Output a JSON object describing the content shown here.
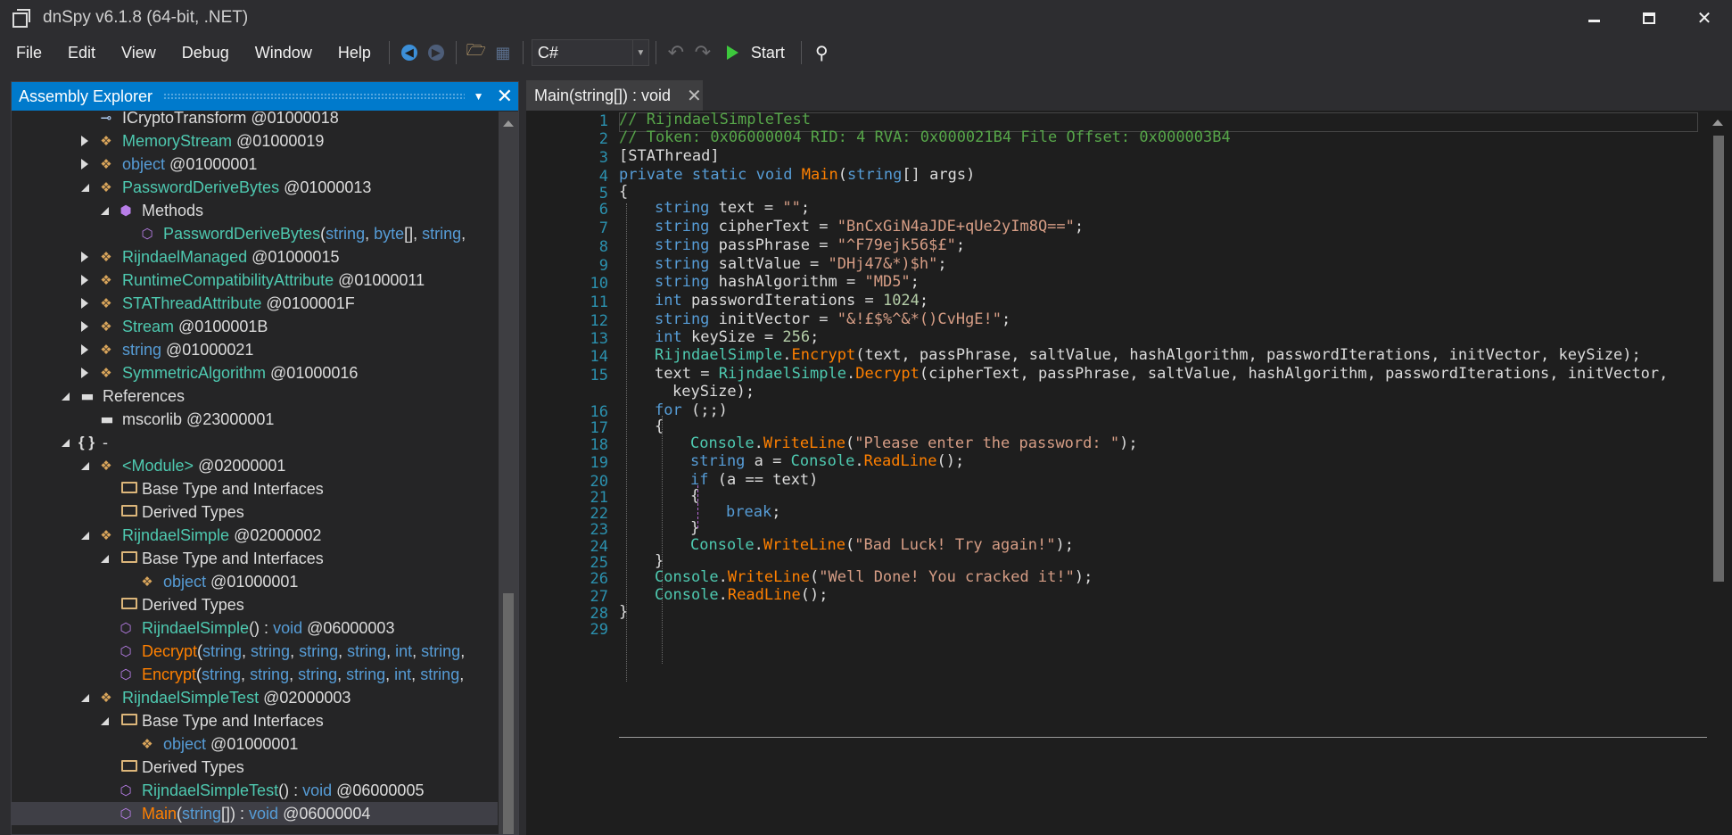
{
  "window": {
    "title": "dnSpy v6.1.8 (64-bit, .NET)"
  },
  "menu": [
    "File",
    "Edit",
    "View",
    "Debug",
    "Window",
    "Help"
  ],
  "toolbar": {
    "language": "C#",
    "start_label": "Start"
  },
  "explorer": {
    "title": "Assembly Explorer",
    "rows": [
      {
        "label": "ICryptoTransform",
        "token": "@01000018",
        "icon": "interface-icon",
        "style": "gray"
      },
      {
        "label": "MemoryStream",
        "token": "@01000019",
        "icon": "class-icon",
        "style": "type"
      },
      {
        "label": "object",
        "token": "@01000001",
        "icon": "class-icon",
        "style": "kw"
      },
      {
        "label": "PasswordDeriveBytes",
        "token": "@01000013",
        "icon": "class-icon",
        "style": "type"
      },
      {
        "label": "Methods",
        "token": "",
        "icon": "method-group-icon",
        "style": "gray"
      },
      {
        "label": "PasswordDeriveBytes(string, byte[], string,",
        "token": "",
        "icon": "method-icon",
        "style": "meth"
      },
      {
        "label": "RijndaelManaged",
        "token": "@01000015",
        "icon": "class-icon",
        "style": "type"
      },
      {
        "label": "RuntimeCompatibilityAttribute",
        "token": "@01000011",
        "icon": "class-icon",
        "style": "type"
      },
      {
        "label": "STAThreadAttribute",
        "token": "@0100001F",
        "icon": "class-icon",
        "style": "type"
      },
      {
        "label": "Stream",
        "token": "@0100001B",
        "icon": "class-icon",
        "style": "type"
      },
      {
        "label": "string",
        "token": "@01000021",
        "icon": "class-icon",
        "style": "kw"
      },
      {
        "label": "SymmetricAlgorithm",
        "token": "@01000016",
        "icon": "class-icon",
        "style": "type"
      },
      {
        "label": "References",
        "token": "",
        "icon": "references-icon",
        "style": "gray"
      },
      {
        "label": "mscorlib",
        "token": "@23000001",
        "icon": "reference-icon",
        "style": "gray"
      },
      {
        "label": "-",
        "token": "",
        "icon": "namespace-icon",
        "style": "gray"
      },
      {
        "label": "<Module>",
        "token": "@02000001",
        "icon": "class-icon",
        "style": "type"
      },
      {
        "label": "Base Type and Interfaces",
        "token": "",
        "icon": "folder-icon",
        "style": "gray"
      },
      {
        "label": "Derived Types",
        "token": "",
        "icon": "folder-icon",
        "style": "gray"
      },
      {
        "label": "RijndaelSimple",
        "token": "@02000002",
        "icon": "class-icon",
        "style": "type"
      },
      {
        "label": "Base Type and Interfaces",
        "token": "",
        "icon": "folder-icon",
        "style": "gray"
      },
      {
        "label": "object",
        "token": "@01000001",
        "icon": "class-icon",
        "style": "kw"
      },
      {
        "label": "Derived Types",
        "token": "",
        "icon": "folder-icon",
        "style": "gray"
      },
      {
        "label": "RijndaelSimple() : void",
        "token": "@06000003",
        "icon": "method-icon",
        "style": "meth"
      },
      {
        "label": "Decrypt(string, string, string, string, int, string,",
        "token": "",
        "icon": "method-icon",
        "style": "methcall"
      },
      {
        "label": "Encrypt(string, string, string, string, int, string,",
        "token": "",
        "icon": "method-icon",
        "style": "methcall"
      },
      {
        "label": "RijndaelSimpleTest",
        "token": "@02000003",
        "icon": "class-icon",
        "style": "type"
      },
      {
        "label": "Base Type and Interfaces",
        "token": "",
        "icon": "folder-icon",
        "style": "gray"
      },
      {
        "label": "object",
        "token": "@01000001",
        "icon": "class-icon",
        "style": "kw"
      },
      {
        "label": "Derived Types",
        "token": "",
        "icon": "folder-icon",
        "style": "gray"
      },
      {
        "label": "RijndaelSimpleTest() : void",
        "token": "@06000005",
        "icon": "method-icon",
        "style": "meth"
      },
      {
        "label": "Main(string[]) : void",
        "token": "@06000004",
        "icon": "method-icon",
        "style": "methcall"
      }
    ]
  },
  "editor": {
    "tab_label": "Main(string[]) : void",
    "lines": [
      "// RijndaelSimpleTest",
      "// Token: 0x06000004 RID: 4 RVA: 0x000021B4 File Offset: 0x000003B4",
      "[STAThread]",
      "private static void Main(string[] args)",
      "{",
      "string text = \"\";",
      "string cipherText = \"BnCxGiN4aJDE+qUe2yIm8Q==\";",
      "string passPhrase = \"^F79ejk56$£\";",
      "string saltValue = \"DHj47&*)$h\";",
      "string hashAlgorithm = \"MD5\";",
      "int passwordIterations = 1024;",
      "string initVector = \"&!£$%^&*()CvHgE!\";",
      "int keySize = 256;",
      "RijndaelSimple.Encrypt(text, passPhrase, saltValue, hashAlgorithm, passwordIterations, initVector, keySize);",
      "text = RijndaelSimple.Decrypt(cipherText, passPhrase, saltValue, hashAlgorithm, passwordIterations, initVector,",
      "keySize);",
      "for (;;)",
      "{",
      "Console.WriteLine(\"Please enter the password: \");",
      "string a = Console.ReadLine();",
      "if (a == text)",
      "{",
      "break;",
      "}",
      "Console.WriteLine(\"Bad Luck! Try again!\");",
      "}",
      "Console.WriteLine(\"Well Done! You cracked it!\");",
      "Console.ReadLine();",
      "}"
    ],
    "line_numbers": [
      "1",
      "2",
      "3",
      "4",
      "5",
      "6",
      "7",
      "8",
      "9",
      "10",
      "11",
      "12",
      "13",
      "14",
      "15",
      "16",
      "17",
      "18",
      "19",
      "20",
      "21",
      "22",
      "23",
      "24",
      "25",
      "26",
      "27",
      "28",
      "29"
    ]
  },
  "colors": {
    "accent": "#007acc",
    "keyword": "#569cd6",
    "type": "#4ec9b0",
    "string": "#d69d85",
    "comment": "#57a64a",
    "method": "#ff8000",
    "line_number": "#2b91af"
  }
}
